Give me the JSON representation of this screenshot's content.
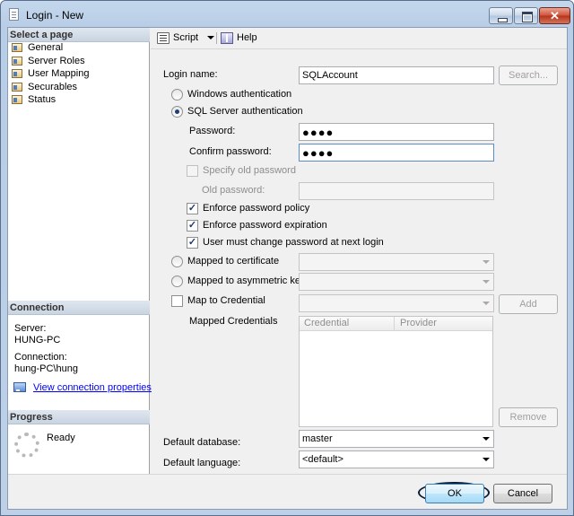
{
  "window": {
    "title": "Login - New"
  },
  "left_pane": {
    "select_page_header": "Select a page",
    "pages": [
      {
        "label": "General"
      },
      {
        "label": "Server Roles"
      },
      {
        "label": "User Mapping"
      },
      {
        "label": "Securables"
      },
      {
        "label": "Status"
      }
    ],
    "connection_header": "Connection",
    "server_label": "Server:",
    "server_value": "HUNG-PC",
    "connection_label": "Connection:",
    "connection_value": "hung-PC\\hung",
    "view_properties_link": "View connection properties",
    "progress_header": "Progress",
    "progress_status": "Ready"
  },
  "toolbar": {
    "script_label": "Script",
    "help_label": "Help"
  },
  "form": {
    "login_name_label": "Login name:",
    "login_name_value": "SQLAccount",
    "search_button": "Search...",
    "windows_auth_label": "Windows authentication",
    "sql_auth_label": "SQL Server authentication",
    "password_label": "Password:",
    "password_value": "●●●●",
    "confirm_password_label": "Confirm password:",
    "confirm_password_value": "●●●●",
    "specify_old_password_label": "Specify old password",
    "old_password_label": "Old password:",
    "enforce_policy_label": "Enforce password policy",
    "enforce_expiration_label": "Enforce password expiration",
    "must_change_label": "User must change password at next login",
    "mapped_certificate_label": "Mapped to certificate",
    "mapped_asymmetric_label": "Mapped to asymmetric key",
    "map_credential_label": "Map to Credential",
    "add_button": "Add",
    "mapped_credentials_label": "Mapped Credentials",
    "credentials_columns": [
      "Credential",
      "Provider"
    ],
    "remove_button": "Remove",
    "default_database_label": "Default database:",
    "default_database_value": "master",
    "default_language_label": "Default language:",
    "default_language_value": "<default>"
  },
  "buttons": {
    "ok": "OK",
    "cancel": "Cancel"
  }
}
